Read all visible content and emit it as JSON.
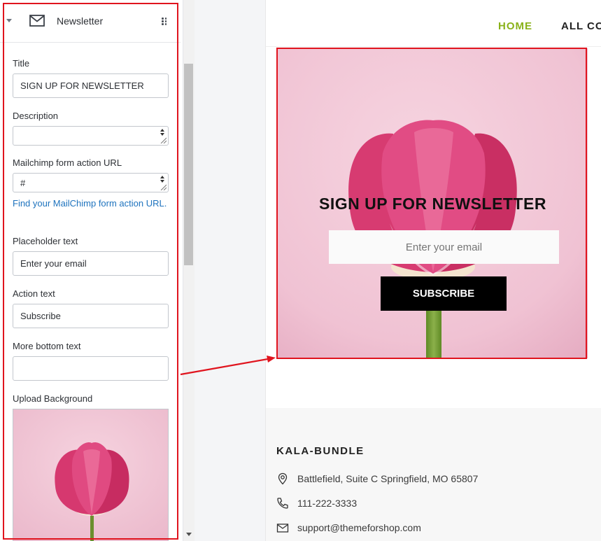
{
  "panel": {
    "title": "Newsletter",
    "fields": {
      "title_label": "Title",
      "title_value": "SIGN UP FOR NEWSLETTER",
      "description_label": "Description",
      "description_value": "",
      "mailchimp_label": "Mailchimp form action URL",
      "mailchimp_value": "#",
      "mailchimp_link": "Find your MailChimp form action URL.",
      "placeholder_label": "Placeholder text",
      "placeholder_value": "Enter your email",
      "action_label": "Action text",
      "action_value": "Subscribe",
      "more_bottom_label": "More bottom text",
      "more_bottom_value": "",
      "upload_label": "Upload Background"
    }
  },
  "preview": {
    "nav": {
      "home": "HOME",
      "all": "ALL CO"
    },
    "newsletter": {
      "title": "SIGN UP FOR NEWSLETTER",
      "email_placeholder": "Enter your email",
      "button": "SUBSCRIBE"
    },
    "footer": {
      "brand": "KALA-BUNDLE",
      "address": "Battlefield, Suite C Springfield, MO 65807",
      "phone": "111-222-3333",
      "email": "support@themeforshop.com"
    }
  },
  "colors": {
    "accent_nav": "#8ab21a",
    "highlight": "#e0141e",
    "link": "#1e73be"
  }
}
